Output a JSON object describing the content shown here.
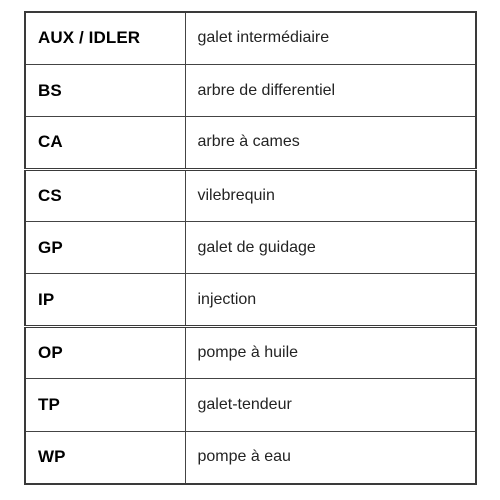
{
  "page": {
    "background_color": "#ffffff",
    "border_color": "#3a3a3a",
    "rule_color": "#444444",
    "text_color": "#000000"
  },
  "table": {
    "name": "abbreviation-legend",
    "columns": [
      {
        "key": "abbr",
        "header": ""
      },
      {
        "key": "term",
        "header": ""
      }
    ],
    "rows": [
      {
        "abbr": "AUX / IDLER",
        "term": "galet intermédiaire"
      },
      {
        "abbr": "BS",
        "term": "arbre de differentiel"
      },
      {
        "abbr": "CA",
        "term": "arbre à cames"
      },
      {
        "abbr": "CS",
        "term": "vilebrequin"
      },
      {
        "abbr": "GP",
        "term": "galet de guidage"
      },
      {
        "abbr": "IP",
        "term": "injection"
      },
      {
        "abbr": "OP",
        "term": "pompe à huile"
      },
      {
        "abbr": "TP",
        "term": "galet-tendeur"
      },
      {
        "abbr": "WP",
        "term": "pompe à eau"
      }
    ]
  }
}
